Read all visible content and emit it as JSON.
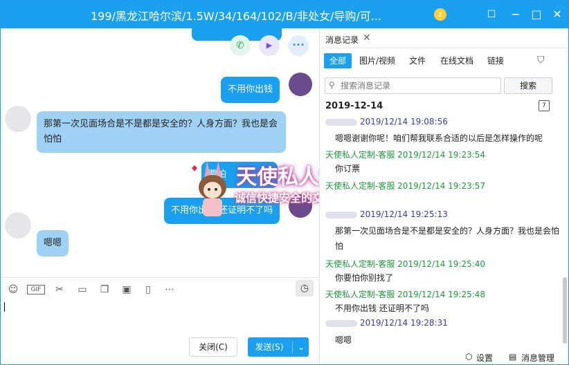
{
  "window": {
    "title": "199/黑龙江哈尔滨/1.5W/34/164/102/B/非处女/导购/可...",
    "badge": "z",
    "minimize_icon": "−",
    "maximize_icon": "□",
    "close_icon": "✕",
    "pin_icon": "☐"
  },
  "chat_actions": {
    "phone_icon": "✆",
    "video_icon": "▶",
    "more_icon": "•••"
  },
  "messages": [
    {
      "dir": "out",
      "text": "不用你出钱"
    },
    {
      "dir": "in",
      "text": "那第一次见面场合是不是都是安全的？人身方面？我也是会怕怕"
    },
    {
      "dir": "out",
      "text": "要怕"
    },
    {
      "dir": "out",
      "text": "不用你出钱 还证明不了吗"
    },
    {
      "dir": "in",
      "text": "嗯嗯"
    }
  ],
  "watermark": {
    "title": "天使私人订制",
    "subtitle": "诚信快捷安全的交友平台"
  },
  "input_toolbar": {
    "emoji_icon": "☺",
    "gif_label": "GIF",
    "scissors_icon": "✂",
    "folder_icon": "▭",
    "doc_icon": "❐",
    "image_icon": "▣",
    "shake_icon": "▯",
    "more_icon": "⋯",
    "history_icon": "◷"
  },
  "buttons": {
    "close": "关闭(C)",
    "send": "发送(S)",
    "send_dropdown": "⌄"
  },
  "history_panel": {
    "tab_label": "消息记录",
    "tab_close": "✕",
    "filters": [
      "全部",
      "图片/视频",
      "文件",
      "在线文档",
      "链接"
    ],
    "filter_icon": "⛉",
    "search_placeholder": "搜索消息记录",
    "search_button": "搜索",
    "date": "2019-12-14",
    "calendar_icon": "7",
    "records": [
      {
        "who": "user",
        "time": "2019/12/14 19:08:56",
        "text": "嗯嗯谢谢你呢！咱们帮我联系合适的以后是怎样操作的呢"
      },
      {
        "who": "agent",
        "sender": "天使私人定制-客服",
        "time": "2019/12/14 19:23:54",
        "text": "你订票"
      },
      {
        "who": "agent",
        "sender": "天使私人定制-客服",
        "time": "2019/12/14 19:23:57",
        "text": ""
      },
      {
        "who": "user",
        "time": "2019/12/14 19:25:13",
        "text": "那第一次见面场合是不是都是安全的？人身方面？我也是会怕怕"
      },
      {
        "who": "agent",
        "sender": "天使私人定制-客服",
        "time": "2019/12/14 19:25:40",
        "text": "你要怕你别找了"
      },
      {
        "who": "agent",
        "sender": "天使私人定制-客服",
        "time": "2019/12/14 19:25:48",
        "text": "不用你出钱 还证明不了吗"
      },
      {
        "who": "user",
        "time": "2019/12/14 19:28:31",
        "text": "嗯嗯"
      }
    ],
    "footer": {
      "settings_icon": "⬡",
      "settings": "设置",
      "manage_icon": "▤",
      "manage": "消息管理"
    }
  }
}
